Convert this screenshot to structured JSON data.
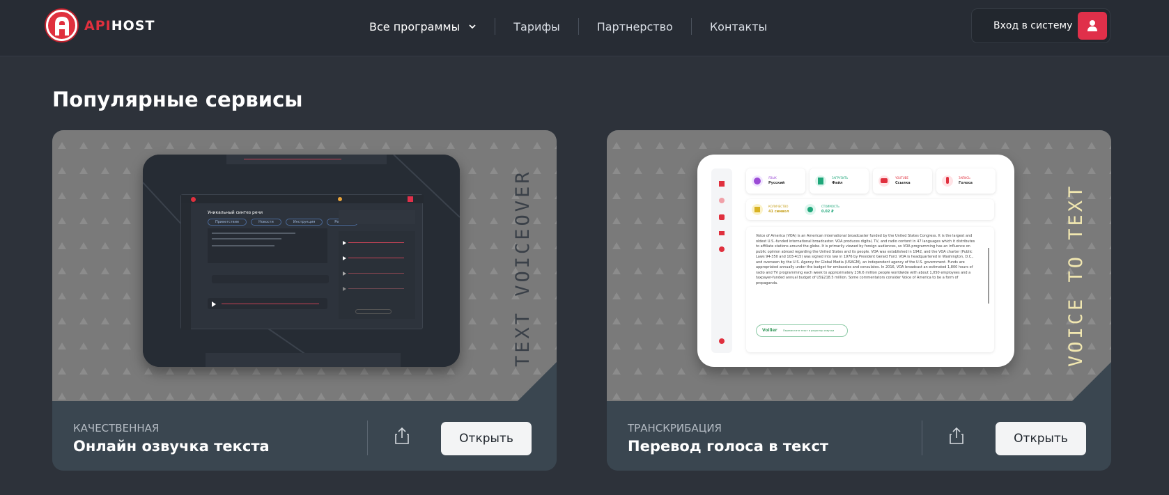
{
  "header": {
    "logo_api": "API",
    "logo_host": "HOST",
    "nav": [
      "Все программы",
      "Тарифы",
      "Партнерство",
      "Контакты"
    ],
    "login_label": "Вход в систему"
  },
  "section_title": "Популярные сервисы",
  "cards": [
    {
      "kicker": "КАЧЕСТВЕННАЯ",
      "title": "Онлайн озвучка текста",
      "button": "Открыть",
      "vertical_text": "TEXT VOICEOVER",
      "mock": {
        "heading": "Уникальный синтез речи",
        "tabs": [
          "Приветствие",
          "Новости",
          "Инструкция",
          "Реклама"
        ]
      }
    },
    {
      "kicker": "ТРАНСКРИБАЦИЯ",
      "title": "Перевод голоса в текст",
      "button": "Открыть",
      "vertical_text": "VOICE TO TEXT",
      "mock": {
        "chips": [
          {
            "small": "ЯЗЫК",
            "big": "Русский"
          },
          {
            "small": "ЗАГРУЗИТЬ",
            "big": "Файл"
          },
          {
            "small": "YOUTUBE",
            "big": "Ссылка"
          },
          {
            "small": "ЗАПИСЬ",
            "big": "Голоса"
          }
        ],
        "stats": [
          {
            "small": "КОЛИЧЕСТВО",
            "big": "41 символ"
          },
          {
            "small": "СТОИМОСТЬ",
            "big": "0.02 ₽"
          }
        ],
        "body": "Voice of America (VOA) is an American international broadcaster funded by the United States Congress. It is the largest and oldest U.S.-funded international broadcaster. VOA produces digital, TV, and radio content in 47 languages which it distributes to affiliate stations around the globe. It is primarily viewed by foreign audiences, so VOA programming has an influence on public opinion abroad regarding the United States and its people. VOA was established in 1942, and the VOA charter (Public Laws 94-350 and 103-415) was signed into law in 1976 by President Gerald Ford. VOA is headquartered in Washington, D.C., and overseen by the U.S. Agency for Global Media (USAGM), an independent agency of the U.S. government. Funds are appropriated annually under the budget for embassies and consulates. In 2016, VOA broadcast an estimated 1,800 hours of radio and TV programming each week to approximately 236.6 million people worldwide with about 1,050 employees and a taxpayer-funded annual budget of US$218.5 million. Some commentators consider Voice of America to be a form of propaganda.",
        "editor_logo": "Voilier",
        "editor_label": "Переместите текст в редактор озвучки"
      }
    }
  ]
}
